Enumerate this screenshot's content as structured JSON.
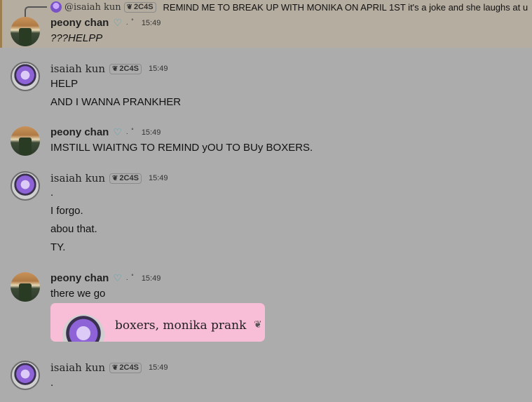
{
  "reply_preview": {
    "name": "@isaiah kun",
    "tag": "2C4S",
    "text": "REMIND ME TO BREAK UP WITH MONIKA ON APRIL 1ST it's a joke and she laughs at u"
  },
  "messages": [
    {
      "author": "peony chan",
      "badge": "♡",
      "badge_extra": ". ˚",
      "time": "15:49",
      "lines": [
        "???HELPP"
      ]
    },
    {
      "author": "isaiah kun",
      "tag": "2C4S",
      "time": "15:49",
      "lines": [
        "HELP",
        "AND I WANNA PRANKHER"
      ]
    },
    {
      "author": "peony chan",
      "badge": "♡",
      "badge_extra": ". ˚",
      "time": "15:49",
      "lines": [
        "IMSTILL WIAITNG TO REMIND yOU TO BUy BOXERS."
      ]
    },
    {
      "author": "isaiah kun",
      "tag": "2C4S",
      "time": "15:49",
      "lines": [
        ".",
        "I forgo.",
        "abou that.",
        "TY."
      ]
    },
    {
      "author": "peony chan",
      "badge": "♡",
      "badge_extra": ". ˚",
      "time": "15:49",
      "lines": [
        "there we go"
      ],
      "embed": {
        "text": "boxers, monika prank"
      }
    },
    {
      "author": "isaiah kun",
      "tag": "2C4S",
      "time": "15:49",
      "lines": [
        "."
      ]
    }
  ],
  "colors": {
    "background": "#acacac",
    "highlight": "#b6ada1",
    "embed": "#f8bdd7",
    "heart_badge": "#4aa2b8"
  }
}
